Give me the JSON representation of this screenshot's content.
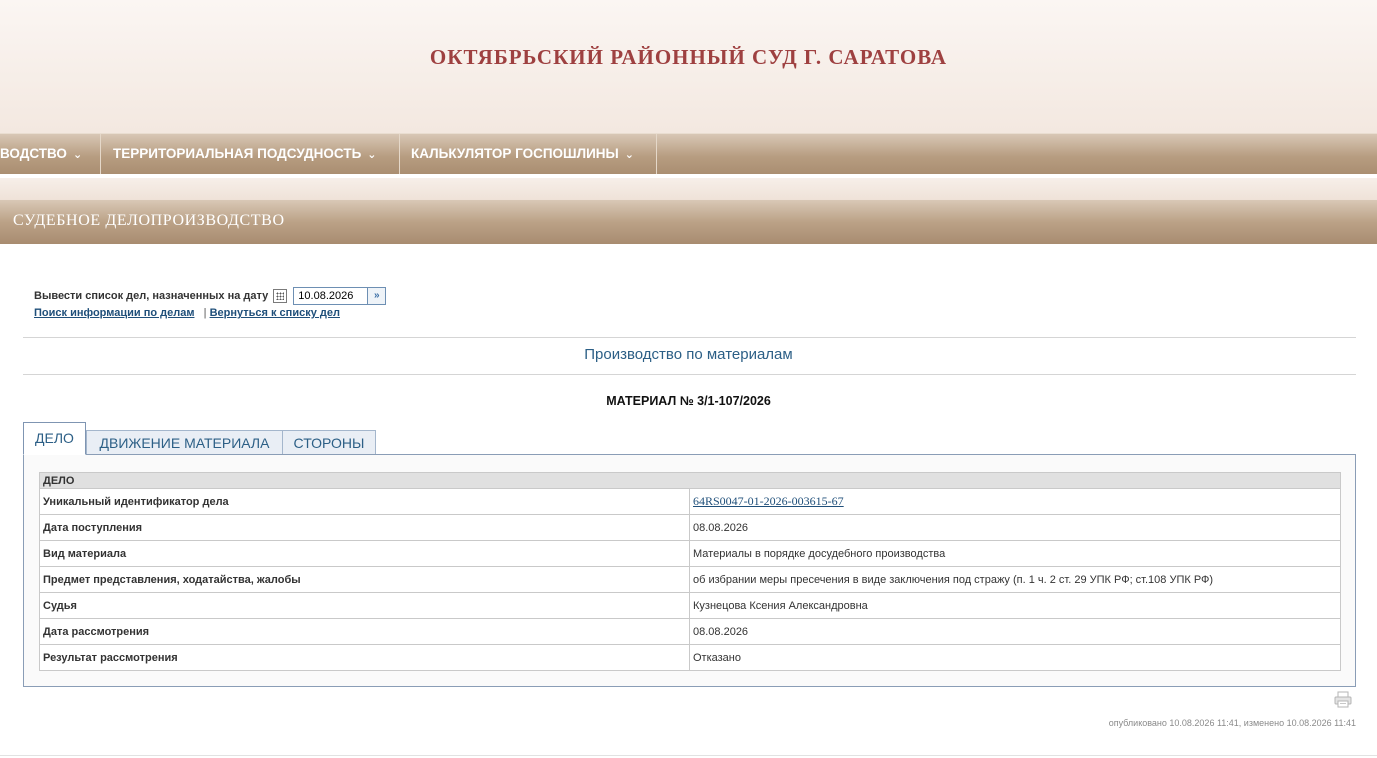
{
  "header": {
    "site_title": "ОКТЯБРЬСКИЙ РАЙОННЫЙ СУД Г. САРАТОВА"
  },
  "nav": {
    "items": [
      {
        "label": "ВОДСТВО"
      },
      {
        "label": "ТЕРРИТОРИАЛЬНАЯ ПОДСУДНОСТЬ"
      },
      {
        "label": "КАЛЬКУЛЯТОР ГОСПОШЛИНЫ"
      }
    ],
    "chevron": "⌄"
  },
  "section": {
    "title": "СУДЕБНОЕ ДЕЛОПРОИЗВОДСТВО"
  },
  "date_filter": {
    "label": "Вывести список дел, назначенных на дату",
    "value": "10.08.2026",
    "go": "»"
  },
  "links": {
    "search": "Поиск информации по делам",
    "separator": "|",
    "back": "Вернуться к списку дел"
  },
  "production_title": "Производство по материалам",
  "material_title": "МАТЕРИАЛ № 3/1-107/2026",
  "tabs": [
    {
      "label": "ДЕЛО",
      "active": true
    },
    {
      "label": "ДВИЖЕНИЕ МАТЕРИАЛА",
      "active": false
    },
    {
      "label": "СТОРОНЫ",
      "active": false
    }
  ],
  "case_table": {
    "header": "ДЕЛО",
    "rows": [
      {
        "key": "Уникальный идентификатор дела",
        "value": "64RS0047-01-2026-003615-67"
      },
      {
        "key": "Дата поступления",
        "value": "08.08.2026"
      },
      {
        "key": "Вид материала",
        "value": "Материалы в порядке досудебного производства"
      },
      {
        "key": "Предмет представления, ходатайства, жалобы",
        "value": "об избрании меры пресечения в виде заключения под стражу (п. 1 ч. 2 ст. 29 УПК РФ; ст.108 УПК РФ)"
      },
      {
        "key": "Судья",
        "value": "Кузнецова Ксения Александровна"
      },
      {
        "key": "Дата рассмотрения",
        "value": "08.08.2026"
      },
      {
        "key": "Результат рассмотрения",
        "value": "Отказано"
      }
    ]
  },
  "icons": {
    "print": "print-icon",
    "calendar": "calendar-icon"
  },
  "footer": {
    "note": "опубликовано 10.08.2026 11:41, изменено 10.08.2026 11:41"
  }
}
